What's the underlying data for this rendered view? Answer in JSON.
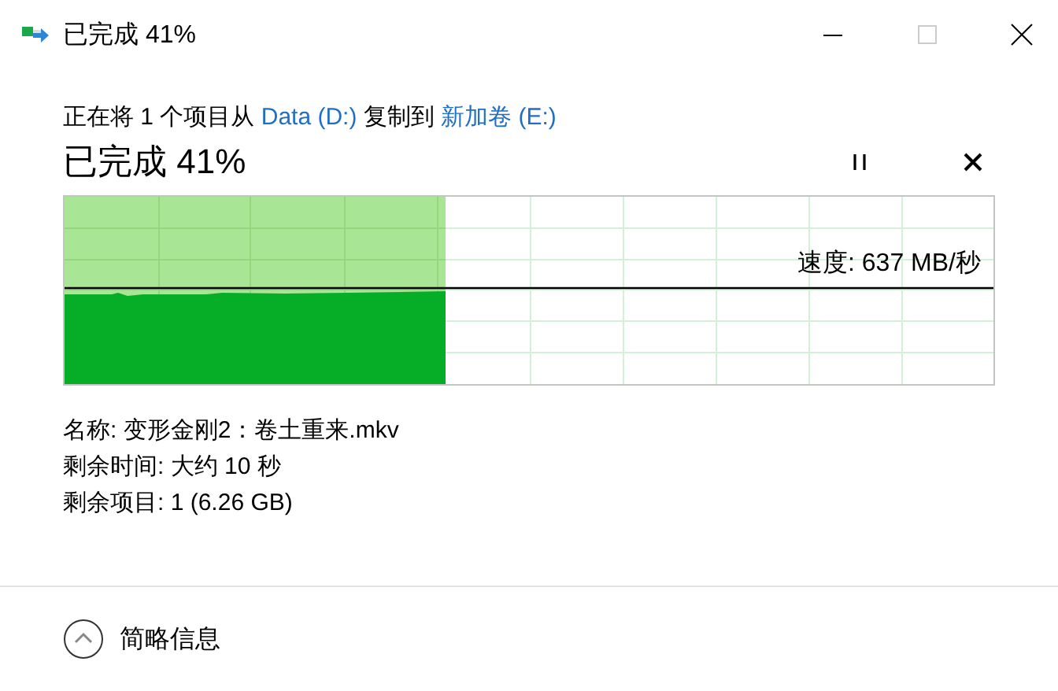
{
  "window": {
    "title": "已完成 41%"
  },
  "description": [
    {
      "kind": "text",
      "text": "正在将 1 个项目从 "
    },
    {
      "kind": "link",
      "text": "Data (D:)"
    },
    {
      "kind": "text",
      "text": " 复制到 "
    },
    {
      "kind": "link",
      "text": "新加卷 (E:)"
    }
  ],
  "heading": "已完成 41%",
  "progress": {
    "level": 0.41,
    "speed": "速度: 637 MB/秒"
  },
  "details": [
    "名称: 变形金刚2：卷土重来.mkv",
    "剩余时间: 大约 10 秒",
    "剩余项目: 1 (6.26 GB)"
  ],
  "footer": {
    "label": "简略信息",
    "expanded": true
  }
}
